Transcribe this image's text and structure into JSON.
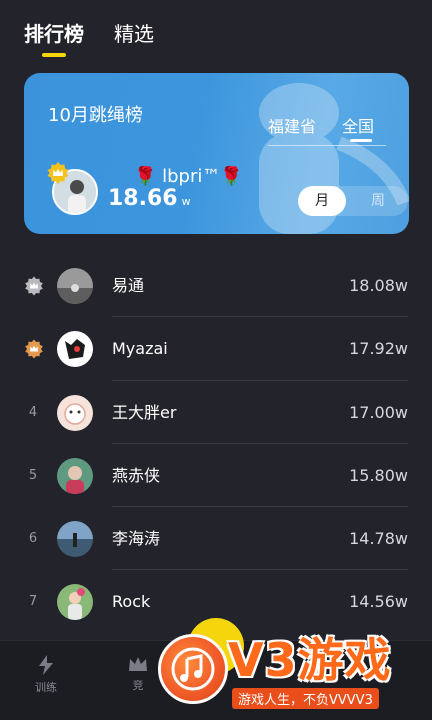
{
  "top_tabs": [
    {
      "label": "排行榜",
      "active": true
    },
    {
      "label": "精选",
      "active": false
    }
  ],
  "hero": {
    "title": "10月跳绳榜",
    "region_tabs": [
      {
        "label": "福建省",
        "active": false
      },
      {
        "label": "全国",
        "active": true
      }
    ],
    "user_name": "🌹 lbpri™🌹",
    "score": "18.66",
    "unit": "w",
    "period": {
      "month": "月",
      "week": "周",
      "selected": "月"
    }
  },
  "ranking": [
    {
      "rank": "1",
      "medal": "silver",
      "name": "易通",
      "score": "18.08w",
      "avatar_color": "#8c8c8c"
    },
    {
      "rank": "2",
      "medal": "bronze",
      "name": "Myazai",
      "score": "17.92w",
      "avatar_color": "#ffffff"
    },
    {
      "rank": "4",
      "name": "王大胖er",
      "score": "17.00w",
      "avatar_color": "#f3d7d0"
    },
    {
      "rank": "5",
      "name": "燕赤侠",
      "score": "15.80w",
      "avatar_color": "#6e9f86"
    },
    {
      "rank": "6",
      "name": "李海涛",
      "score": "14.78w",
      "avatar_color": "#5b7f9e"
    },
    {
      "rank": "7",
      "name": "Rock",
      "score": "14.56w",
      "avatar_color": "#7aa56b"
    }
  ],
  "bottom_nav": [
    {
      "label": "训练",
      "icon": "lightning-icon"
    },
    {
      "label": "竞",
      "icon": "crown-icon"
    }
  ],
  "watermark": {
    "brand": "V3游戏",
    "tagline": "游戏人生，不负VVVV3"
  },
  "colors": {
    "accent": "#f5d60c",
    "card": "#3d96dd",
    "background": "#23232b"
  }
}
